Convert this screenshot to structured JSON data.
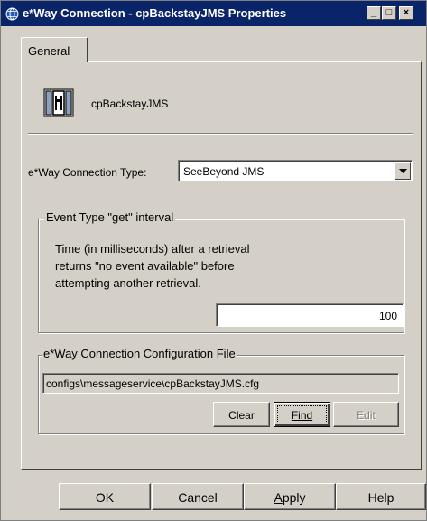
{
  "window": {
    "title": "e*Way Connection - cpBackstayJMS Properties",
    "controls": {
      "minimize": "_",
      "maximize": "□",
      "close": "×"
    }
  },
  "tabs": [
    {
      "label": "General"
    }
  ],
  "connection": {
    "name": "cpBackstayJMS",
    "icon": "connection-icon"
  },
  "type": {
    "label": "e*Way Connection Type:",
    "value": "SeeBeyond JMS"
  },
  "event_group": {
    "title": "Event Type \"get\" interval",
    "description": [
      "Time (in milliseconds) after a retrieval",
      "returns \"no event available\" before",
      "attempting another retrieval."
    ],
    "interval_value": "100"
  },
  "config_group": {
    "title": "e*Way Connection Configuration File",
    "path": "configs\\messageservice\\cpBackstayJMS.cfg",
    "buttons": {
      "clear": "Clear",
      "find": "Find",
      "edit": "Edit"
    }
  },
  "footer": {
    "ok": "OK",
    "cancel": "Cancel",
    "apply_prefix": "",
    "apply_underlined": "A",
    "apply_rest": "pply",
    "help": "Help"
  },
  "colors": {
    "titlebar": "#0a246a",
    "face": "#d4d0c8"
  }
}
